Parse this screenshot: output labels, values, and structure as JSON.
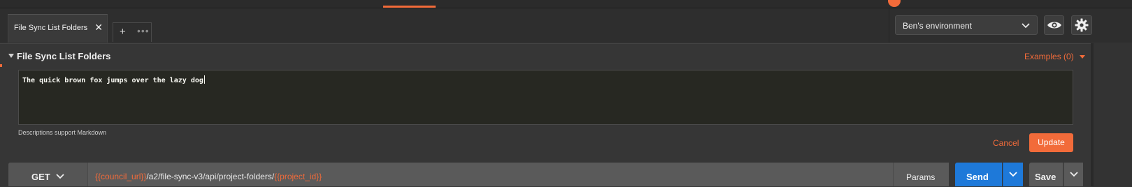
{
  "tabs": [
    {
      "label": "File Sync List Folders",
      "close": "✕"
    }
  ],
  "tab_tools": {
    "add": "+",
    "more": "•••"
  },
  "environment": {
    "selected": "Ben's environment"
  },
  "request": {
    "title": "File Sync List Folders",
    "examples_label": "Examples (0)",
    "description": "The quick brown fox jumps over the lazy dog",
    "description_hint": "Descriptions support Markdown",
    "cancel_label": "Cancel",
    "update_label": "Update"
  },
  "urlbar": {
    "method": "GET",
    "url_var_1": "{{council_url}}",
    "url_path": "/a2/file-sync-v3/api/project-folders/",
    "url_var_2": "{{project_id}}",
    "params_label": "Params",
    "send_label": "Send",
    "save_label": "Save"
  },
  "colors": {
    "accent": "#f26b3a",
    "send": "#1e79d9",
    "background": "#333333",
    "editor": "#272822"
  },
  "icons": [
    "close-icon",
    "plus-icon",
    "more-icon",
    "chevron-down-icon",
    "eye-icon",
    "gear-icon",
    "collapse-triangle-icon",
    "caret-down-icon"
  ]
}
